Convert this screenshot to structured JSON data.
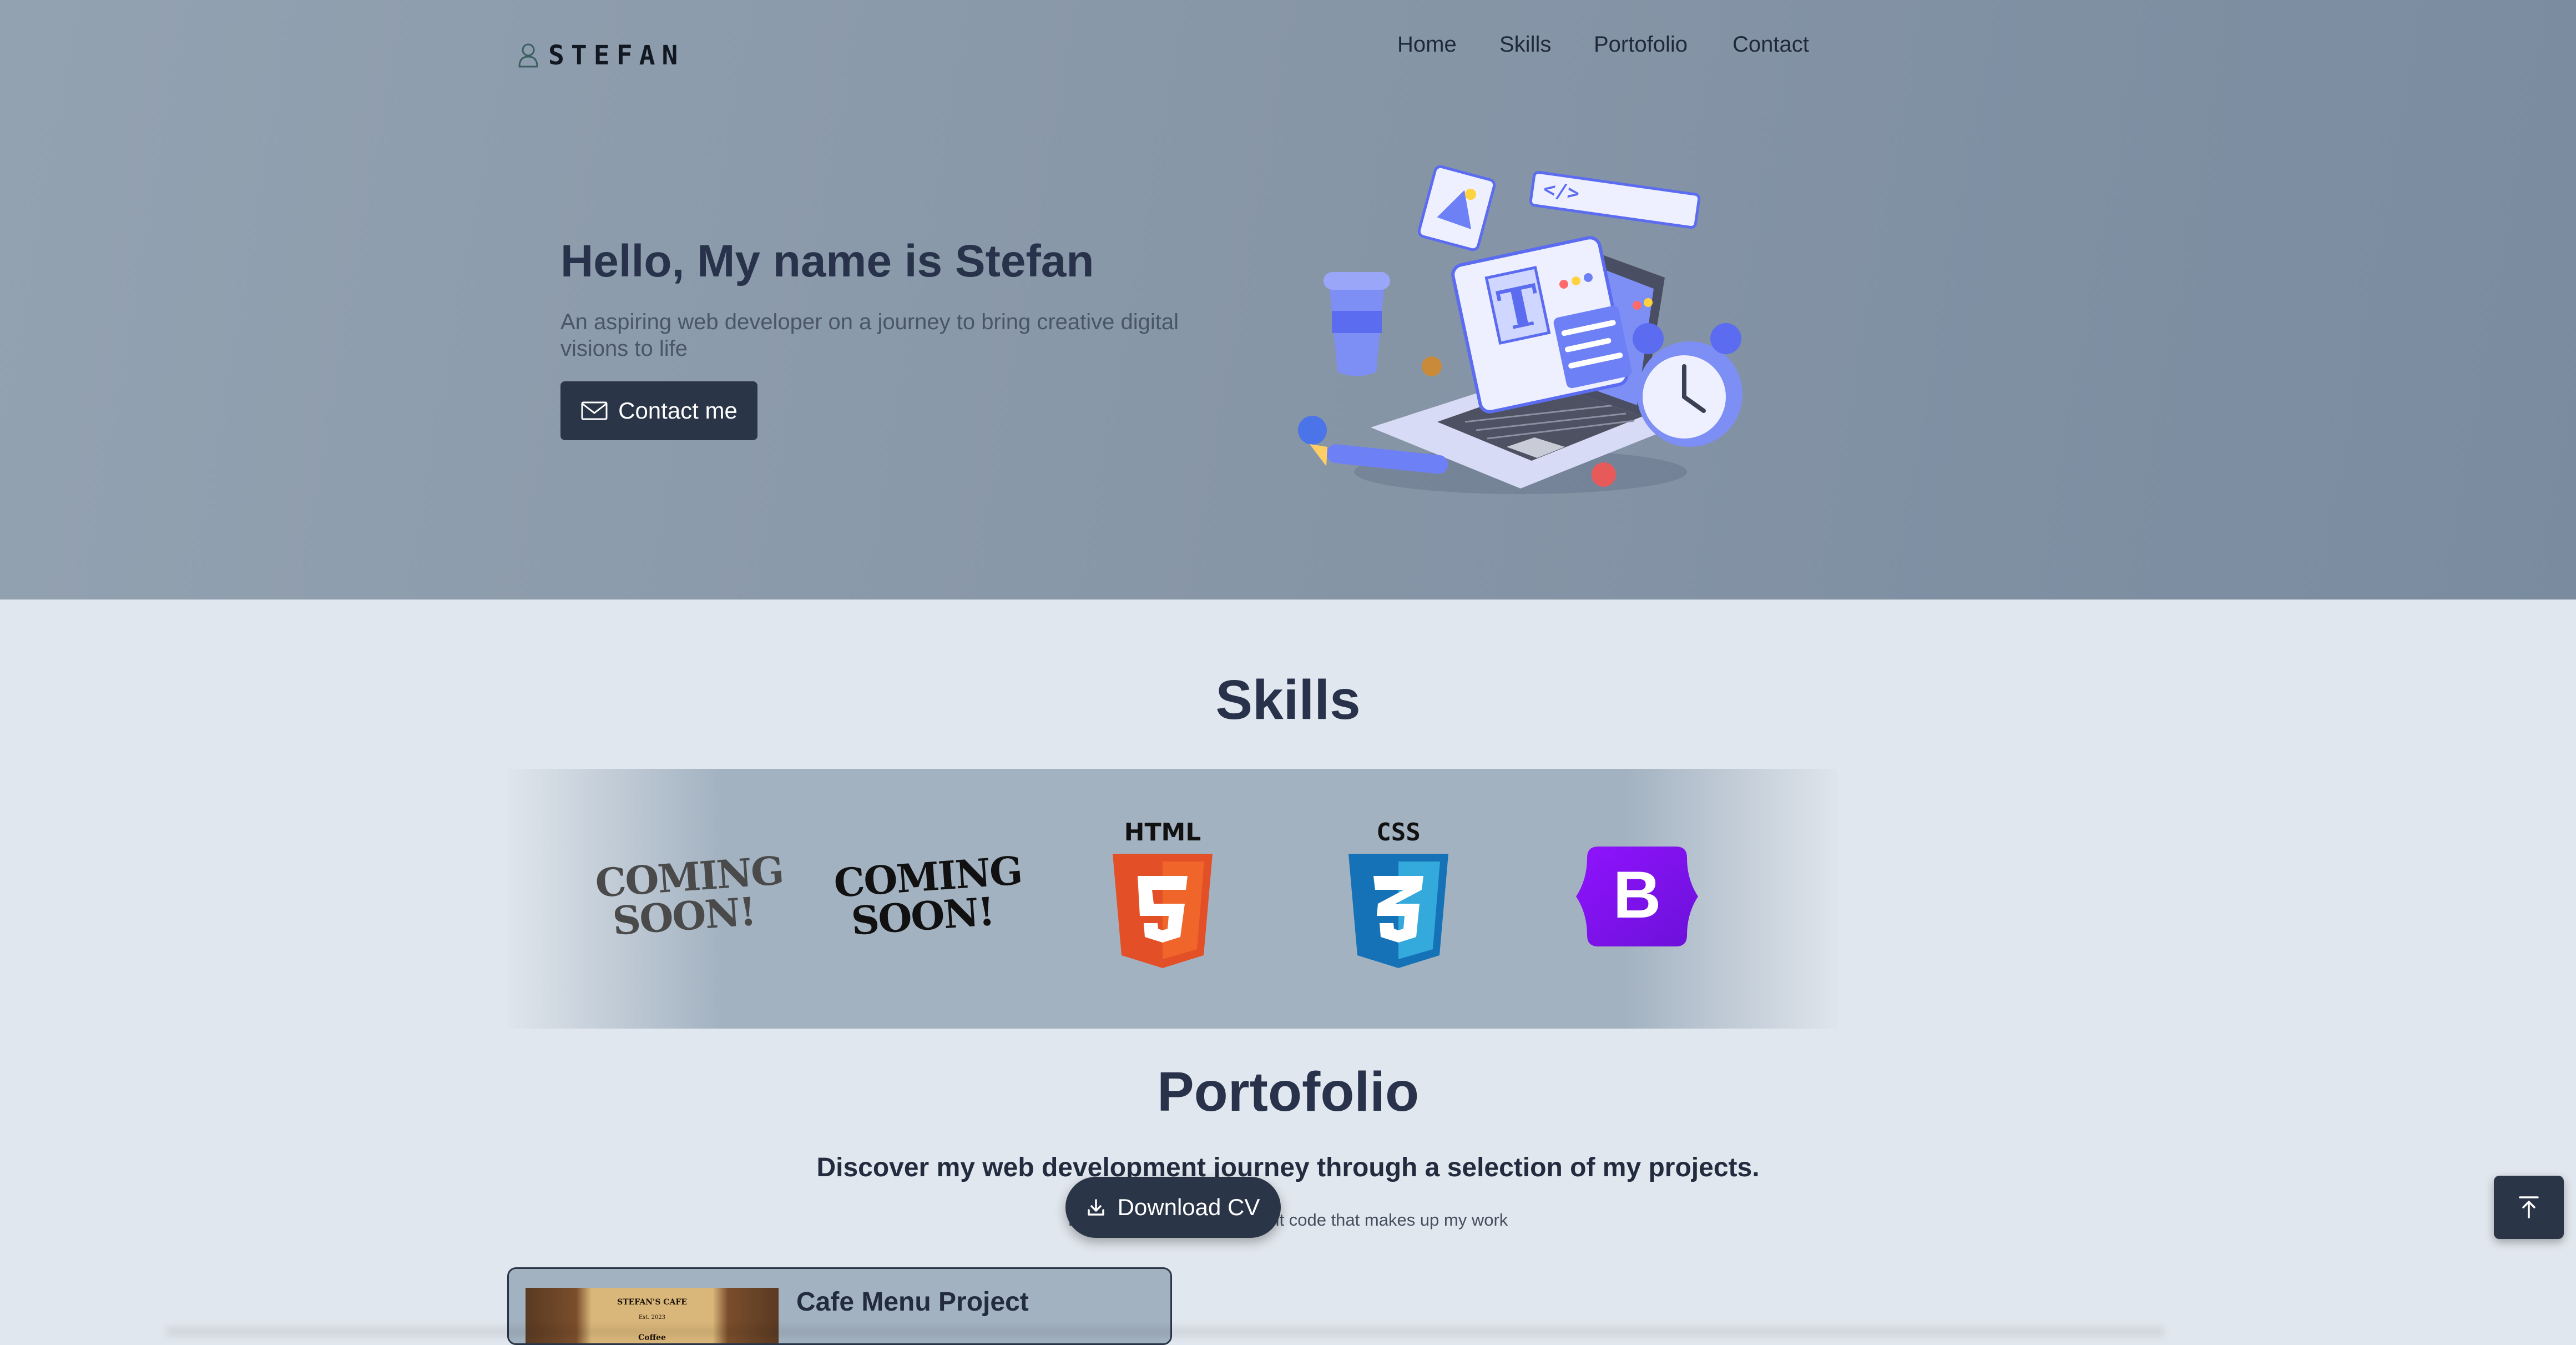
{
  "brand": {
    "name": "STEFAN",
    "icon": "person-icon"
  },
  "nav": {
    "items": [
      "Home",
      "Skills",
      "Portofolio",
      "Contact"
    ]
  },
  "hero": {
    "title": "Hello, My name is Stefan",
    "subtitle": "An aspiring web developer on a journey to bring creative digital visions to life",
    "contact_label": "Contact me",
    "contact_icon": "envelope-icon",
    "illustration": "laptop-workspace-illustration"
  },
  "skills": {
    "title": "Skills",
    "items": [
      {
        "label": "COMING SOON!",
        "kind": "placeholder"
      },
      {
        "label": "COMING SOON!",
        "kind": "placeholder"
      },
      {
        "label": "HTML",
        "icon": "html5-logo-icon"
      },
      {
        "label": "CSS",
        "icon": "css3-logo-icon"
      },
      {
        "label": "B",
        "icon": "bootstrap-logo-icon"
      }
    ]
  },
  "portfolio": {
    "title": "Portofolio",
    "subtitle": "Discover my web development journey through a selection of my projects.",
    "description": "Dive in and explore the excit code that makes up my work",
    "projects": [
      {
        "title": "Cafe Menu Project",
        "thumb_title": "STEFAN'S CAFE",
        "thumb_sub": "Est. 2023",
        "thumb_heading": "Coffee"
      }
    ]
  },
  "download": {
    "label": "Download CV",
    "icon": "download-icon"
  },
  "scroll_top": {
    "icon": "arrow-up-to-top-icon"
  },
  "colors": {
    "dark": "#2a3547",
    "hero_bg": "#8796a7",
    "page_bg": "#e1e7ee",
    "html5": "#e34f26",
    "css3": "#1572b6",
    "bootstrap": "#7952b3"
  }
}
